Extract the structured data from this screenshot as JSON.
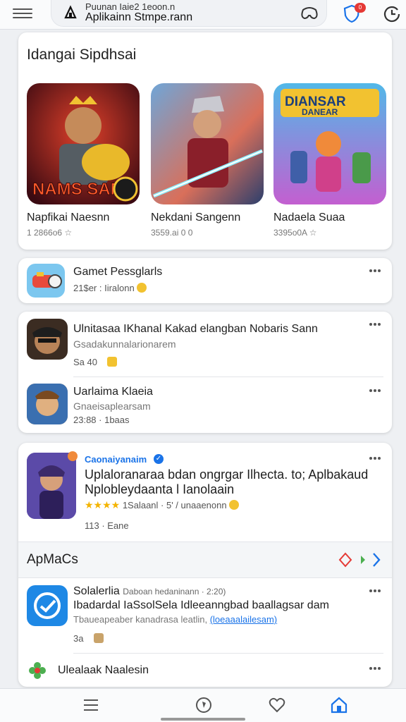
{
  "search": {
    "line1": "Puunan Iaie2 1eoon.n",
    "line2": "Aplikainn Stmpe.rann"
  },
  "topbar": {
    "notification_count": "0"
  },
  "featured": {
    "title": "Idangai Sipdhsai",
    "items": [
      {
        "name": "Napfikai Naesnn",
        "meta": "1 2866o6 ☆",
        "art_text": "NAMS SAME"
      },
      {
        "name": "Nekdani Sangenn",
        "meta": "3559.ai 0 0",
        "art_text": ""
      },
      {
        "name": "Nadaela Suaa",
        "meta": "3395o0A ☆",
        "art_text": "DIANSAR DANEAR"
      }
    ]
  },
  "single_app": {
    "title": "Gamet Pessglarls",
    "meta": "21$er : Iiralonn"
  },
  "list_a": [
    {
      "title": "Ulnitasaa IKhanal Kakad elangban Nobaris Sann",
      "sub": "Gsadakunnalarionarem",
      "meta": "Sa 40"
    },
    {
      "title": "Uarlaima Klaeia",
      "sub": "Gnaeisaplearsam",
      "meta": "23:88 · 1baas"
    }
  ],
  "promo": {
    "dev": "Caonaiyanaim",
    "title1": "Uplaloranaraa bdan ongrgar Ilhecta. to; Aplbakaud",
    "title2": "Nplobleydaanta l Ianolaain",
    "rating": "★★★★",
    "rating_text": "1Salaanl · 5' / unaaenonn",
    "meta": "113 · Eane"
  },
  "apmacs": {
    "title": "ApMaCs",
    "app": {
      "title": "Solalerlia",
      "title_extra": "Daboan hedaninann · 2:20)",
      "line2": "Ibadardal IaSsolSela Idleeanngbad baallagsar dam",
      "line3": "Tbaueapeaber kanadrasa leatlin,",
      "link": "(loeaaalailesam)",
      "meta": "3a"
    },
    "last_item": "Ulealaak Naalesin"
  },
  "colors": {
    "accent": "#1a73e8",
    "badge": "#e53935",
    "star": "#f4b400"
  }
}
